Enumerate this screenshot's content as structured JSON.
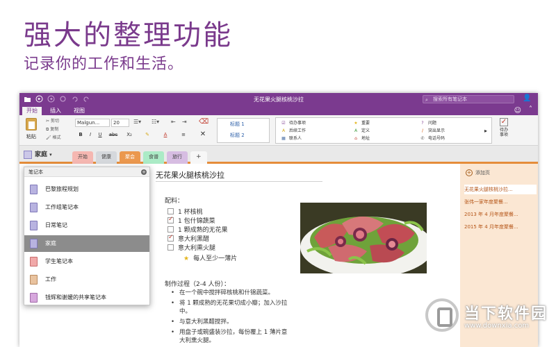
{
  "hero": {
    "title": "强大的整理功能",
    "subtitle": "记录你的工作和生活。"
  },
  "window": {
    "title": "无花果火腿核桃沙拉",
    "search_placeholder": "搜索所有笔记本",
    "ribbon_tabs": [
      "开始",
      "插入",
      "视图"
    ],
    "active_tab": "开始"
  },
  "ribbon": {
    "paste_label": "粘贴",
    "clipboard": [
      "剪切",
      "复制",
      "格式"
    ],
    "font_name": "Malgun...",
    "font_size": "20",
    "format_buttons": [
      "B",
      "I",
      "U",
      "abc",
      "X₂",
      "A"
    ],
    "styles": [
      "标题 1",
      "标题 2"
    ],
    "tags": [
      {
        "icon": "☑",
        "label": "待办事项",
        "color": "#7b3a8f"
      },
      {
        "icon": "A",
        "label": "后续工作",
        "color": "#d6a91a"
      },
      {
        "icon": "▦",
        "label": "联系人",
        "color": "#4a6fa5"
      },
      {
        "icon": "★",
        "label": "重要",
        "color": "#e3b41b"
      },
      {
        "icon": "A",
        "label": "定义",
        "color": "#3c9a3c"
      },
      {
        "icon": "⌂",
        "label": "地址",
        "color": "#c0392b"
      },
      {
        "icon": "?",
        "label": "问题",
        "color": "#7b3a8f"
      },
      {
        "icon": "/",
        "label": "突出显示",
        "color": "#d35400"
      },
      {
        "icon": "✆",
        "label": "电话号码",
        "color": "#555555"
      }
    ],
    "todo_label": "待办\n事项"
  },
  "notebook": {
    "name": "家庭",
    "sections": [
      {
        "label": "开始",
        "color": "#f5b7b1"
      },
      {
        "label": "健康",
        "color": "#d5d8dc"
      },
      {
        "label": "聚会",
        "color": "#eb984e"
      },
      {
        "label": "食谱",
        "color": "#abebc6"
      },
      {
        "label": "旅行",
        "color": "#d7bde2"
      }
    ],
    "active_section": "聚会"
  },
  "notebook_panel": {
    "header": "笔记本",
    "items": [
      {
        "label": "巴黎旅程规划",
        "color": "#b8b3e0"
      },
      {
        "label": "工作组笔记本",
        "color": "#b8b3e0"
      },
      {
        "label": "日常笔记",
        "color": "#b8b3e0"
      },
      {
        "label": "家庭",
        "color": "#b8b3e0"
      },
      {
        "label": "学生笔记本",
        "color": "#f1a9a9"
      },
      {
        "label": "工作",
        "color": "#e9c39f"
      },
      {
        "label": "钱辉和谢媛的共享笔记本",
        "color": "#d7a8dd"
      }
    ],
    "selected": "家庭"
  },
  "page": {
    "title": "无花果火腿核桃沙拉",
    "ingredients_heading": "配料：",
    "ingredients": [
      {
        "text": "1 杯核桃",
        "checked": false
      },
      {
        "text": "1 包什锦蔬菜",
        "checked": true
      },
      {
        "text": "1 颗成熟的无花果",
        "checked": false
      },
      {
        "text": "意大利黑醋",
        "checked": true
      },
      {
        "text": "意大利熏火腿",
        "checked": false
      }
    ],
    "starred_note": "每人至少一薄片",
    "process_heading": "制作过程（2-4 人份）：",
    "steps": [
      "在一个碗中搅拌碎核桃和什锦蔬菜。",
      "将 1 颗成熟的无花果切成小瓣；加入沙拉中。",
      "与意大利黑醋搅拌。",
      "用盘子或碗盛装沙拉，每份覆上 1 薄片意大利熏火腿。"
    ]
  },
  "page_list": {
    "add_label": "添加页",
    "pages": [
      "无花果火腿核桃沙拉...",
      "张伟一家年度聚餐...",
      "2013 年 4 月年度聚餐...",
      "2015 年 4 月年度聚餐..."
    ],
    "selected_index": 0
  },
  "watermark": {
    "brand": "当下软件园",
    "url": "www.downxia.com"
  },
  "colors": {
    "accent": "#7b3a8f",
    "section_orange": "#e58d3a",
    "pagelist_bg": "#fbe7d3"
  }
}
